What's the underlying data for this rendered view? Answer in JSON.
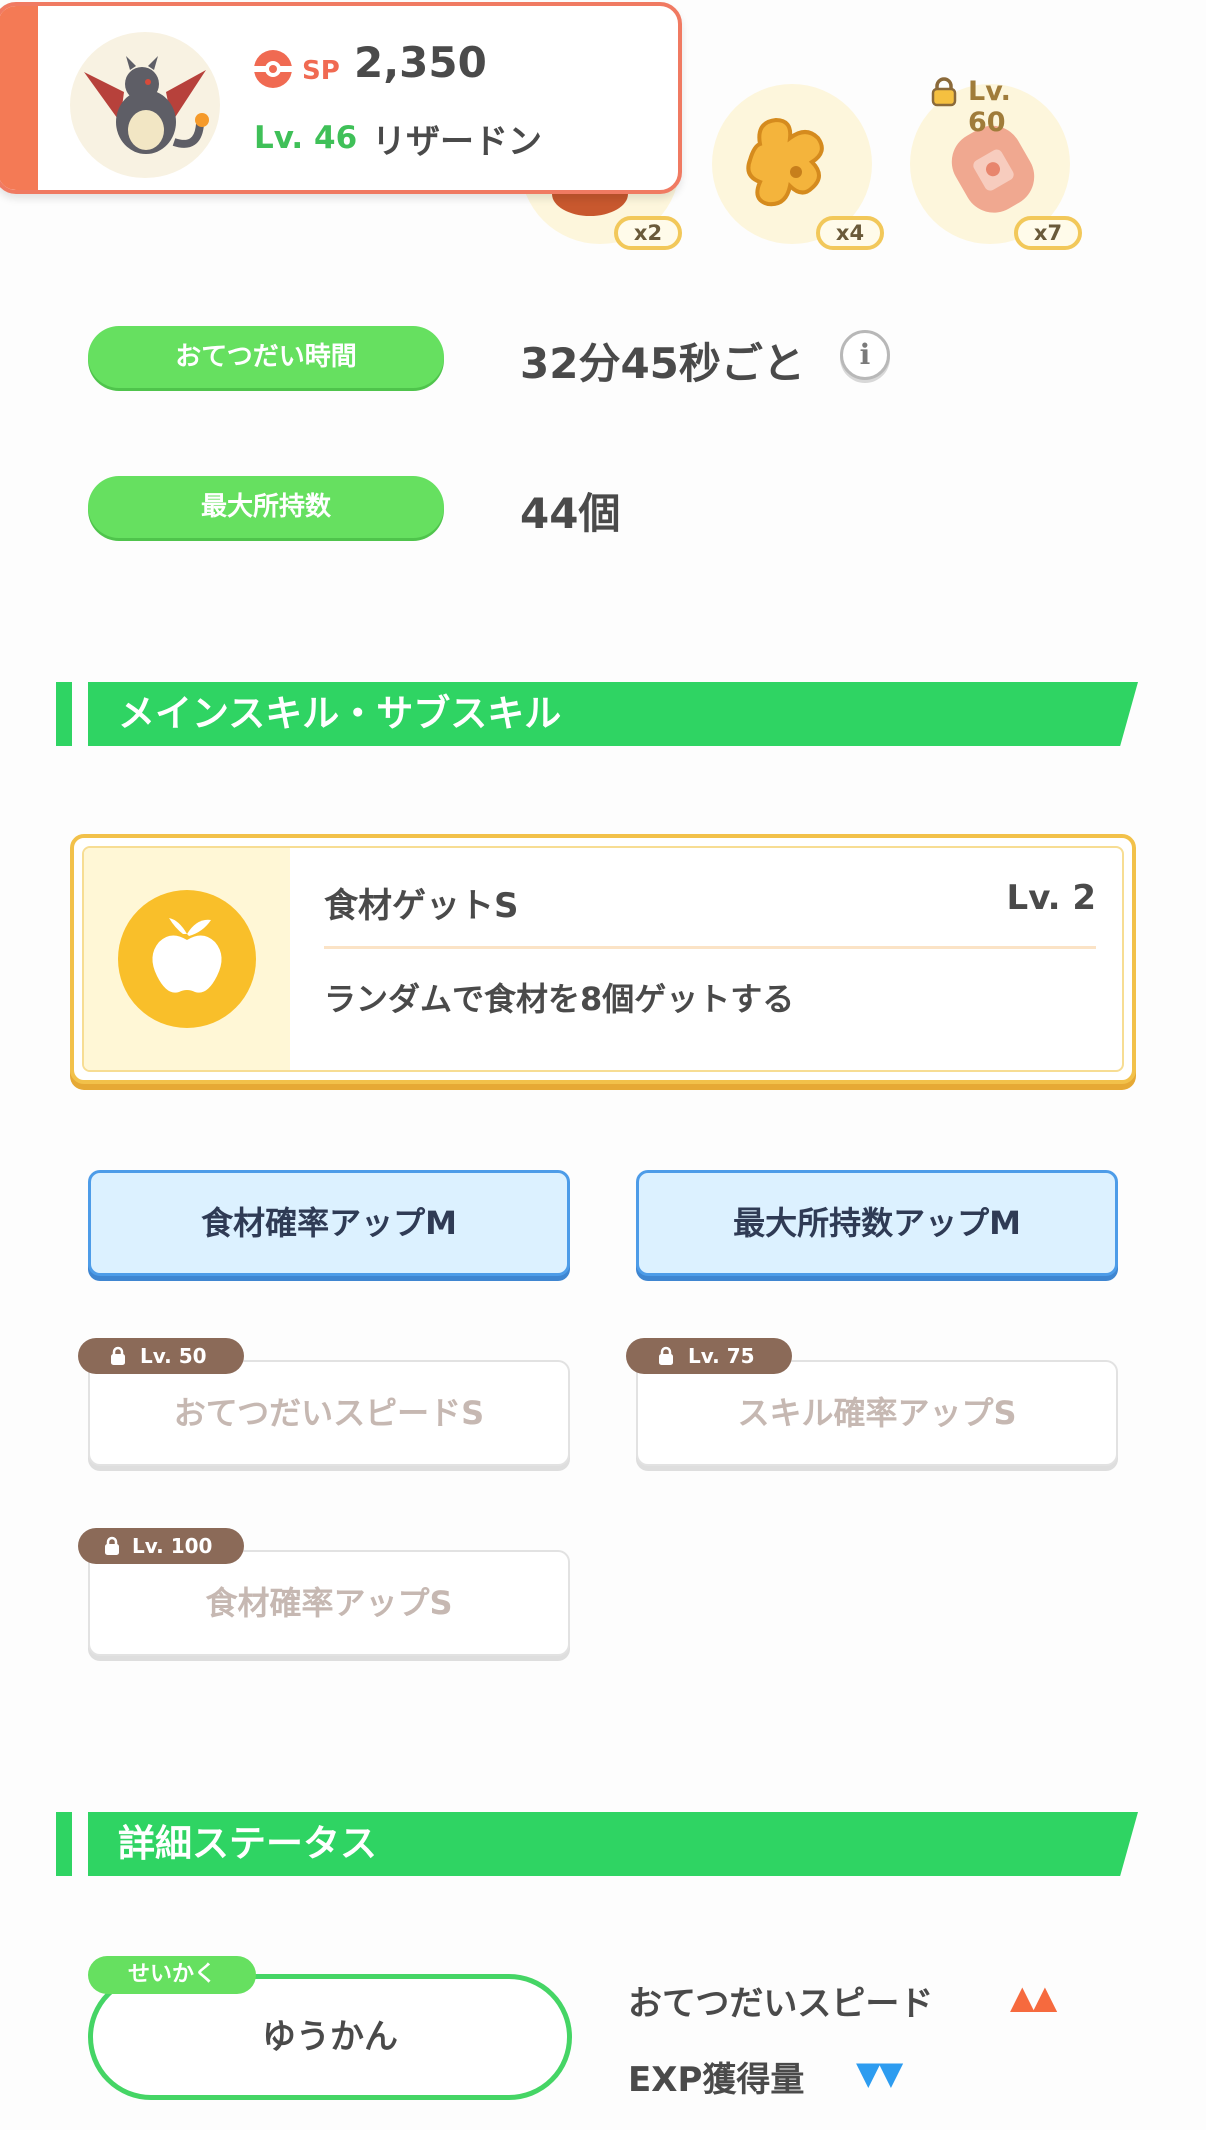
{
  "ingredients": [
    {
      "name": "ingredient-1",
      "count": "x2",
      "lock_label": ""
    },
    {
      "name": "ginger",
      "count": "x4",
      "lock_label": ""
    },
    {
      "name": "sausage",
      "count": "x7",
      "lock_label": "Lv. 60"
    }
  ],
  "pokemon": {
    "sp_label": "SP",
    "sp_value": "2,350",
    "level": "Lv. 46",
    "name": "リザードン"
  },
  "info": {
    "help_time_label": "おてつだい時間",
    "help_time_value": "32分45秒ごと",
    "max_carry_label": "最大所持数",
    "max_carry_value": "44個",
    "info_icon": "i"
  },
  "sections": {
    "skills_title": "メインスキル・サブスキル",
    "details_title": "詳細ステータス"
  },
  "main_skill": {
    "name": "食材ゲットS",
    "level": "Lv. 2",
    "description": "ランダムで食材を8個ゲットする",
    "icon": "apple-icon"
  },
  "sub_skills": [
    {
      "label": "食材確率アップM",
      "locked": false,
      "lock_level": ""
    },
    {
      "label": "最大所持数アップM",
      "locked": false,
      "lock_level": ""
    },
    {
      "label": "おてつだいスピードS",
      "locked": true,
      "lock_level": "Lv. 50"
    },
    {
      "label": "スキル確率アップS",
      "locked": true,
      "lock_level": "Lv. 75"
    },
    {
      "label": "食材確率アップS",
      "locked": true,
      "lock_level": "Lv. 100"
    }
  ],
  "nature": {
    "tag": "せいかく",
    "value": "ゆうかん",
    "effects": [
      {
        "label": "おてつだいスピード",
        "arrows": "▲▲",
        "color": "#f66a3e"
      },
      {
        "label": "EXP獲得量",
        "arrows": "▼▼",
        "color": "#2d9cf0"
      }
    ]
  },
  "colors": {
    "accent_green": "#2fd463",
    "pill_green": "#66e060",
    "card_orange": "#f47a55",
    "skill_gold": "#f9bf2a",
    "subskill_blue": "#4d9ce8",
    "lock_brown": "#8b6a58"
  }
}
